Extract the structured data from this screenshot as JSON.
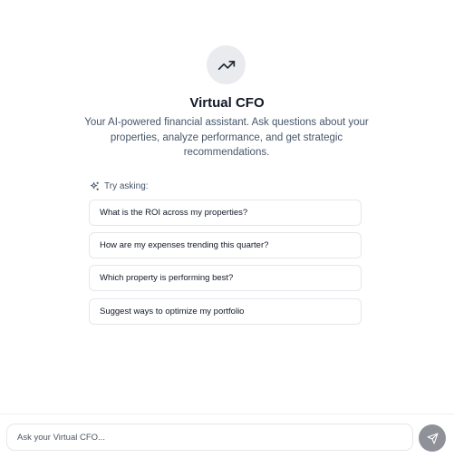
{
  "hero": {
    "icon": "trending-up-icon",
    "title": "Virtual CFO",
    "subtitle": "Your AI-powered financial assistant. Ask questions about your properties, analyze performance, and get strategic recommendations."
  },
  "suggestions": {
    "heading_icon": "sparkles-icon",
    "heading": "Try asking:",
    "items": [
      "What is the ROI across my properties?",
      "How are my expenses trending this quarter?",
      "Which property is performing best?",
      "Suggest ways to optimize my portfolio"
    ]
  },
  "composer": {
    "placeholder": "Ask your Virtual CFO...",
    "value": "",
    "send_icon": "send-icon"
  },
  "colors": {
    "icon_bg": "#e9ebee",
    "subtitle": "#475569",
    "border": "#e5e7eb",
    "send_bg": "#8e9298"
  }
}
